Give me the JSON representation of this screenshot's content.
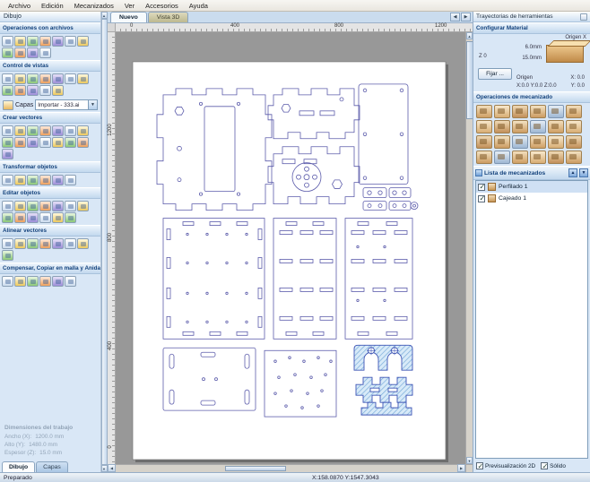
{
  "menu": {
    "items": [
      "Archivo",
      "Edición",
      "Mecanizados",
      "Ver",
      "Accesorios",
      "Ayuda"
    ]
  },
  "canvas": {
    "tabs": [
      {
        "label": "Nuevo"
      },
      {
        "label": "Vista 3D"
      }
    ],
    "ruler_top": [
      "0",
      "400",
      "800",
      "1200"
    ],
    "ruler_left": [
      "1200",
      "800",
      "400",
      "0"
    ]
  },
  "left_panel": {
    "title": "Dibujo",
    "file_ops": {
      "label": "Operaciones con archivos",
      "icons": [
        "new-file-icon",
        "open-file-icon",
        "save-file-icon",
        "import-vectors-icon",
        "export-vectors-icon",
        "print-icon",
        "help-icon",
        "cut-icon",
        "copy-icon",
        "paste-icon",
        "undo-icon"
      ]
    },
    "view_control": {
      "label": "Control de vistas",
      "icons": [
        "zoom-window-icon",
        "zoom-in-icon",
        "zoom-out-icon",
        "zoom-extents-icon",
        "zoom-selection-icon",
        "pan-view-icon",
        "previous-zoom-icon",
        "refresh-view-icon",
        "toggle-rulers-icon",
        "toggle-guides-icon",
        "snap-grid-icon",
        "toggle-grid-icon"
      ]
    },
    "layers": {
      "label": "Capas",
      "value": "Importar - 333.ai"
    },
    "create_vectors": {
      "label": "Crear vectores",
      "icons": [
        "draw-circle-icon",
        "draw-ellipse-icon",
        "draw-rectangle-icon",
        "draw-polygon-icon",
        "draw-star-icon",
        "draw-gear-icon",
        "draw-line-icon",
        "draw-bezier-icon",
        "draw-arc-icon",
        "draw-s-curve-icon",
        "draw-text-icon",
        "text-on-curve-icon",
        "text-spacing-icon",
        "dimension-icon",
        "draw-weave-icon"
      ]
    },
    "transform_objects": {
      "label": "Transformar objetos",
      "icons": [
        "move-selection-icon",
        "set-size-icon",
        "rotate-icon",
        "mirror-icon",
        "distort-icon",
        "align-objects-icon"
      ]
    },
    "edit_objects": {
      "label": "Editar objetos",
      "icons": [
        "node-edit-icon",
        "measure-icon",
        "join-vectors-icon",
        "close-vector-icon",
        "trim-vectors-icon",
        "extend-vectors-icon",
        "fillet-icon",
        "weld-vectors-icon",
        "subtract-vectors-icon",
        "overlap-vectors-icon",
        "group-icon",
        "ungroup-icon",
        "delete-icon"
      ]
    },
    "align_vectors": {
      "label": "Alinear vectores",
      "icons": [
        "align-left-icon",
        "align-center-icon",
        "align-right-icon",
        "align-top-icon",
        "align-middle-icon",
        "align-bottom-icon",
        "center-in-material-icon",
        "space-evenly-icon"
      ]
    },
    "offset_nest": {
      "label": "Compensar, Copiar en malla y Anidar",
      "icons": [
        "offset-vectors-icon",
        "array-copy-icon",
        "circular-copy-icon",
        "copy-along-vector-icon",
        "nest-parts-icon",
        "tile-vectors-icon"
      ]
    },
    "job_dimensions": {
      "title": "Dimensiones del trabajo",
      "rows": [
        {
          "label": "Ancho (X):",
          "value": "1200.0 mm"
        },
        {
          "label": "Alto (Y):",
          "value": "1480.0 mm"
        },
        {
          "label": "Espesor (Z):",
          "value": "15.0 mm"
        }
      ]
    },
    "tabs": [
      {
        "label": "Dibujo"
      },
      {
        "label": "Capas"
      }
    ]
  },
  "right_panel": {
    "title": "Trayectorias de herramientas",
    "material": {
      "header": "Configurar Material",
      "origin_corner": "Origen X",
      "gap": "6.0mm",
      "thickness": "15.0mm",
      "z_zero": "Z 0",
      "set_button": "Fijar ...",
      "origin_label": "Origen",
      "origin_values": "X:0.0 Y:0.0 Z:0.0",
      "x_value": "X: 0.0",
      "y_value": "Y: 0.0"
    },
    "operations": {
      "label": "Operaciones de mecanizado",
      "icons": [
        "profile-toolpath-icon",
        "pocket-toolpath-icon",
        "drilling-toolpath-icon",
        "quick-engrave-icon",
        "inlay-toolpath-icon",
        "vcarve-toolpath-icon",
        "prism-carve-icon",
        "moulding-toolpath-icon",
        "fluting-toolpath-icon",
        "texture-toolpath-icon",
        "drag-knife-icon",
        "laser-cut-icon",
        "toolpath-template-icon",
        "merge-toolpaths-icon",
        "material-setup-icon",
        "job-sheet-icon",
        "preview-toolpaths-icon",
        "save-toolpaths-icon",
        "tool-database-icon",
        "estimate-time-icon",
        "toolpath-tiling-icon",
        "transform-toolpath-icon",
        "copy-toolpath-icon",
        "delete-toolpath-icon"
      ]
    },
    "toolpath_list": {
      "label": "Lista de mecanizados",
      "items": [
        {
          "name": "Perfilado 1",
          "checked": true
        },
        {
          "name": "Cajeado 1",
          "checked": true
        }
      ]
    },
    "footer": {
      "preview2d": "Previsualización 2D",
      "solid": "Sólido"
    }
  },
  "status_bar": {
    "ready": "Preparado",
    "coordinates": "X:158.0870 Y:1547.3043"
  }
}
